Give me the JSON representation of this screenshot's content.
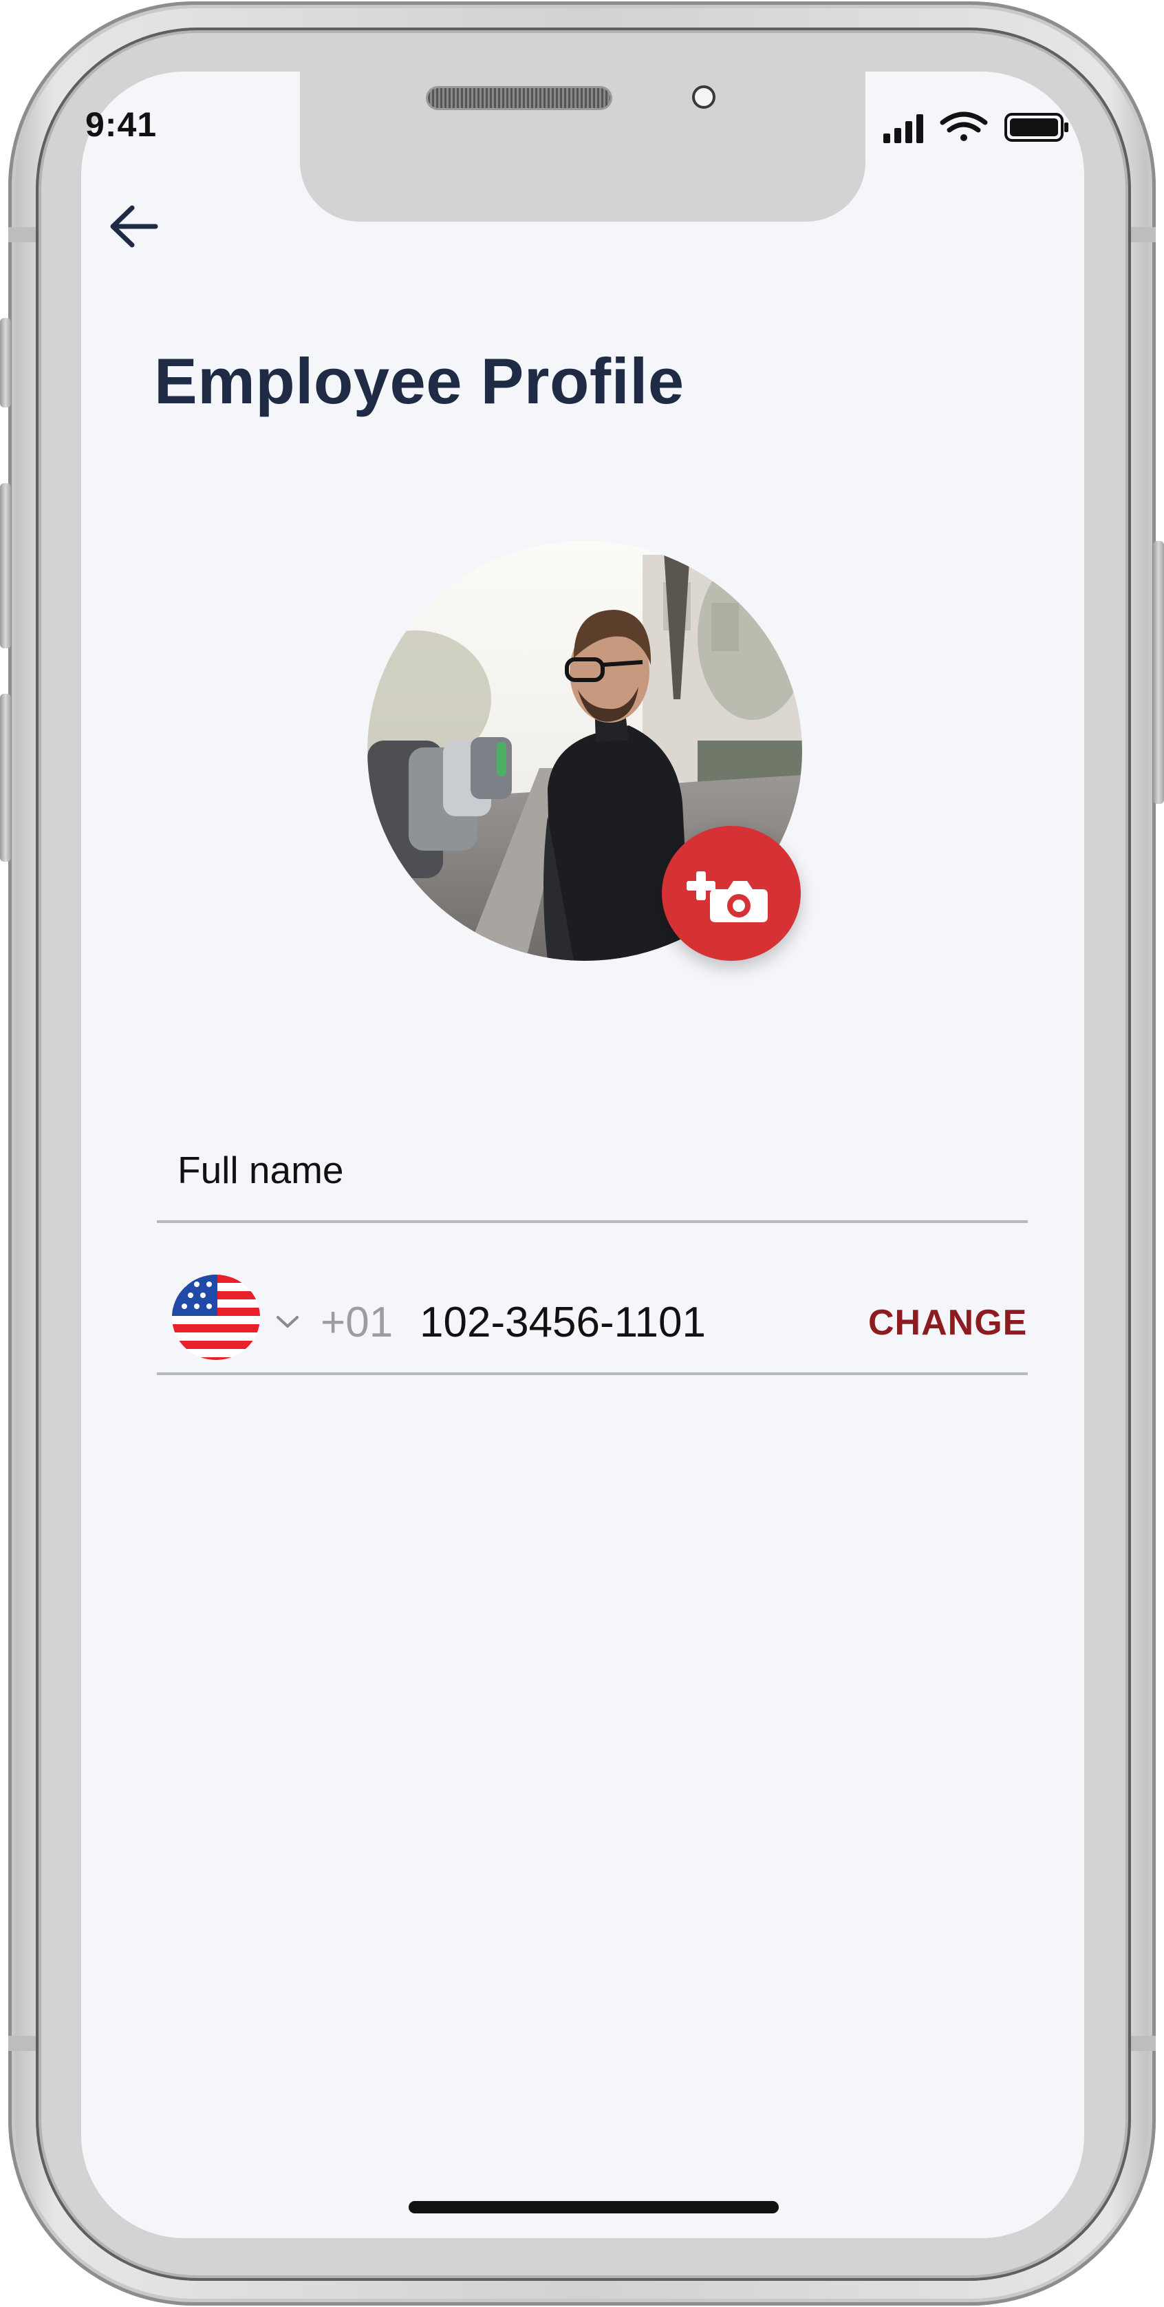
{
  "status_bar": {
    "time": "9:41"
  },
  "header": {
    "back_icon": "arrow-left-icon",
    "title": "Employee Profile"
  },
  "profile_photo": {
    "change_photo_icon": "add-camera-icon"
  },
  "form": {
    "full_name_placeholder": "Full name",
    "phone": {
      "country_flag": "us-flag-icon",
      "country_dropdown_icon": "chevron-down-icon",
      "dial_code": "+01",
      "number": "102-3456-1101",
      "change_label": "CHANGE"
    }
  },
  "colors": {
    "background": "#f5f6fa",
    "title": "#1f2a44",
    "accent": "#d63134",
    "change_link": "#8c1c1f",
    "divider": "#b6b8bf"
  }
}
